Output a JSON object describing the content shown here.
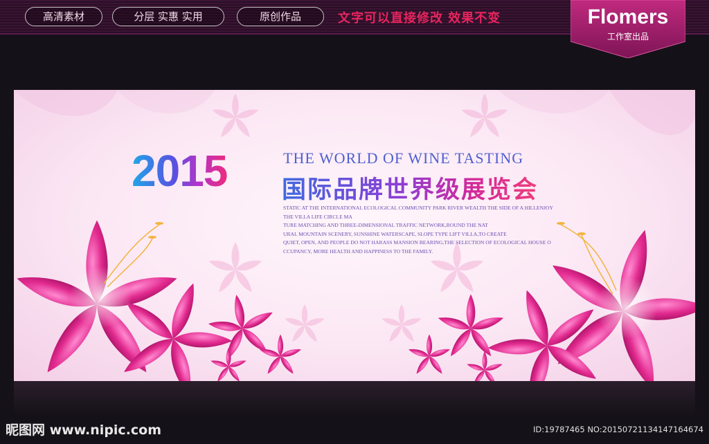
{
  "topbar": {
    "tags": [
      "高清素材",
      "分层 实惠 实用",
      "原创作品"
    ],
    "slogan": "文字可以直接修改 效果不变"
  },
  "brand": {
    "name": "Flomers",
    "subtitle": "工作室出品"
  },
  "banner": {
    "year": "2015",
    "en_title": "THE WORLD OF WINE TASTING",
    "cn_title": "国际品牌世界级展览会",
    "body_lines": [
      "STATIC AT THE INTERNATIONAL ECOLOGICAL COMMUNITY PARK RIVER WEALTH THE SIDE OF A HILLENJOY",
      "THE VILLA LIFE CIRCLE MA",
      "TURE MATCHING AND THREE-DIMENSIONAL TRAFFIC NETWORK,ROUND THE NAT",
      "URAL MOUNTAIN SCENERY, SUNSHINE WATERSCAPE, SLOPE TYPE LIFT VILLA,TO CREATE",
      "QUIET, OPEN, AND PEOPLE DO NOT HARASS MANSION BEARING,THE SELECTION OF ECOLOGICAL HOUSE O",
      "CCUPANCY, MORE HEALTH AND HAPPINESS TO THE FAMILY."
    ]
  },
  "watermark": {
    "left": "昵图网 www.nipic.com",
    "right": "ID:19787465 NO:20150721134147164674"
  },
  "colors": {
    "topbar_bg": "#2a0f26",
    "slogan": "#e8245e",
    "brand_badge": "#a01f6a",
    "flower": "#e0288a"
  }
}
